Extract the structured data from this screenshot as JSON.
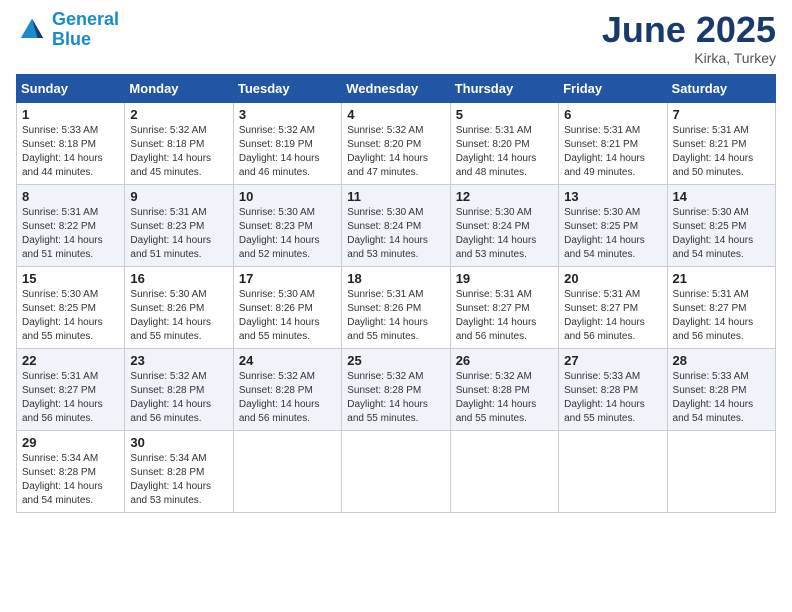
{
  "header": {
    "logo_line1": "General",
    "logo_line2": "Blue",
    "month_title": "June 2025",
    "location": "Kirka, Turkey"
  },
  "weekdays": [
    "Sunday",
    "Monday",
    "Tuesday",
    "Wednesday",
    "Thursday",
    "Friday",
    "Saturday"
  ],
  "weeks": [
    [
      {
        "day": "1",
        "sunrise": "5:33 AM",
        "sunset": "8:18 PM",
        "daylight": "14 hours and 44 minutes."
      },
      {
        "day": "2",
        "sunrise": "5:32 AM",
        "sunset": "8:18 PM",
        "daylight": "14 hours and 45 minutes."
      },
      {
        "day": "3",
        "sunrise": "5:32 AM",
        "sunset": "8:19 PM",
        "daylight": "14 hours and 46 minutes."
      },
      {
        "day": "4",
        "sunrise": "5:32 AM",
        "sunset": "8:20 PM",
        "daylight": "14 hours and 47 minutes."
      },
      {
        "day": "5",
        "sunrise": "5:31 AM",
        "sunset": "8:20 PM",
        "daylight": "14 hours and 48 minutes."
      },
      {
        "day": "6",
        "sunrise": "5:31 AM",
        "sunset": "8:21 PM",
        "daylight": "14 hours and 49 minutes."
      },
      {
        "day": "7",
        "sunrise": "5:31 AM",
        "sunset": "8:21 PM",
        "daylight": "14 hours and 50 minutes."
      }
    ],
    [
      {
        "day": "8",
        "sunrise": "5:31 AM",
        "sunset": "8:22 PM",
        "daylight": "14 hours and 51 minutes."
      },
      {
        "day": "9",
        "sunrise": "5:31 AM",
        "sunset": "8:23 PM",
        "daylight": "14 hours and 51 minutes."
      },
      {
        "day": "10",
        "sunrise": "5:30 AM",
        "sunset": "8:23 PM",
        "daylight": "14 hours and 52 minutes."
      },
      {
        "day": "11",
        "sunrise": "5:30 AM",
        "sunset": "8:24 PM",
        "daylight": "14 hours and 53 minutes."
      },
      {
        "day": "12",
        "sunrise": "5:30 AM",
        "sunset": "8:24 PM",
        "daylight": "14 hours and 53 minutes."
      },
      {
        "day": "13",
        "sunrise": "5:30 AM",
        "sunset": "8:25 PM",
        "daylight": "14 hours and 54 minutes."
      },
      {
        "day": "14",
        "sunrise": "5:30 AM",
        "sunset": "8:25 PM",
        "daylight": "14 hours and 54 minutes."
      }
    ],
    [
      {
        "day": "15",
        "sunrise": "5:30 AM",
        "sunset": "8:25 PM",
        "daylight": "14 hours and 55 minutes."
      },
      {
        "day": "16",
        "sunrise": "5:30 AM",
        "sunset": "8:26 PM",
        "daylight": "14 hours and 55 minutes."
      },
      {
        "day": "17",
        "sunrise": "5:30 AM",
        "sunset": "8:26 PM",
        "daylight": "14 hours and 55 minutes."
      },
      {
        "day": "18",
        "sunrise": "5:31 AM",
        "sunset": "8:26 PM",
        "daylight": "14 hours and 55 minutes."
      },
      {
        "day": "19",
        "sunrise": "5:31 AM",
        "sunset": "8:27 PM",
        "daylight": "14 hours and 56 minutes."
      },
      {
        "day": "20",
        "sunrise": "5:31 AM",
        "sunset": "8:27 PM",
        "daylight": "14 hours and 56 minutes."
      },
      {
        "day": "21",
        "sunrise": "5:31 AM",
        "sunset": "8:27 PM",
        "daylight": "14 hours and 56 minutes."
      }
    ],
    [
      {
        "day": "22",
        "sunrise": "5:31 AM",
        "sunset": "8:27 PM",
        "daylight": "14 hours and 56 minutes."
      },
      {
        "day": "23",
        "sunrise": "5:32 AM",
        "sunset": "8:28 PM",
        "daylight": "14 hours and 56 minutes."
      },
      {
        "day": "24",
        "sunrise": "5:32 AM",
        "sunset": "8:28 PM",
        "daylight": "14 hours and 56 minutes."
      },
      {
        "day": "25",
        "sunrise": "5:32 AM",
        "sunset": "8:28 PM",
        "daylight": "14 hours and 55 minutes."
      },
      {
        "day": "26",
        "sunrise": "5:32 AM",
        "sunset": "8:28 PM",
        "daylight": "14 hours and 55 minutes."
      },
      {
        "day": "27",
        "sunrise": "5:33 AM",
        "sunset": "8:28 PM",
        "daylight": "14 hours and 55 minutes."
      },
      {
        "day": "28",
        "sunrise": "5:33 AM",
        "sunset": "8:28 PM",
        "daylight": "14 hours and 54 minutes."
      }
    ],
    [
      {
        "day": "29",
        "sunrise": "5:34 AM",
        "sunset": "8:28 PM",
        "daylight": "14 hours and 54 minutes."
      },
      {
        "day": "30",
        "sunrise": "5:34 AM",
        "sunset": "8:28 PM",
        "daylight": "14 hours and 53 minutes."
      },
      null,
      null,
      null,
      null,
      null
    ]
  ]
}
